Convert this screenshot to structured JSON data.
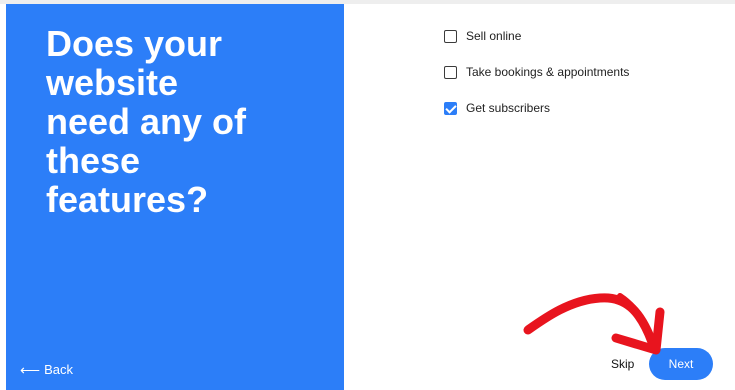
{
  "left_panel": {
    "headline": "Does your\nwebsite\nneed any of\nthese\nfeatures?",
    "back_label": "Back",
    "bg_color": "#2c7ef8"
  },
  "features": [
    {
      "label": "Sell online",
      "checked": false
    },
    {
      "label": "Take bookings & appointments",
      "checked": false
    },
    {
      "label": "Get subscribers",
      "checked": true
    }
  ],
  "footer": {
    "skip_label": "Skip",
    "next_label": "Next"
  },
  "annotation": {
    "arrow_color": "#e8141e",
    "icon": "red-arrow-icon"
  },
  "icons": {
    "back": "arrow-left-icon",
    "check": "checkmark-icon"
  }
}
